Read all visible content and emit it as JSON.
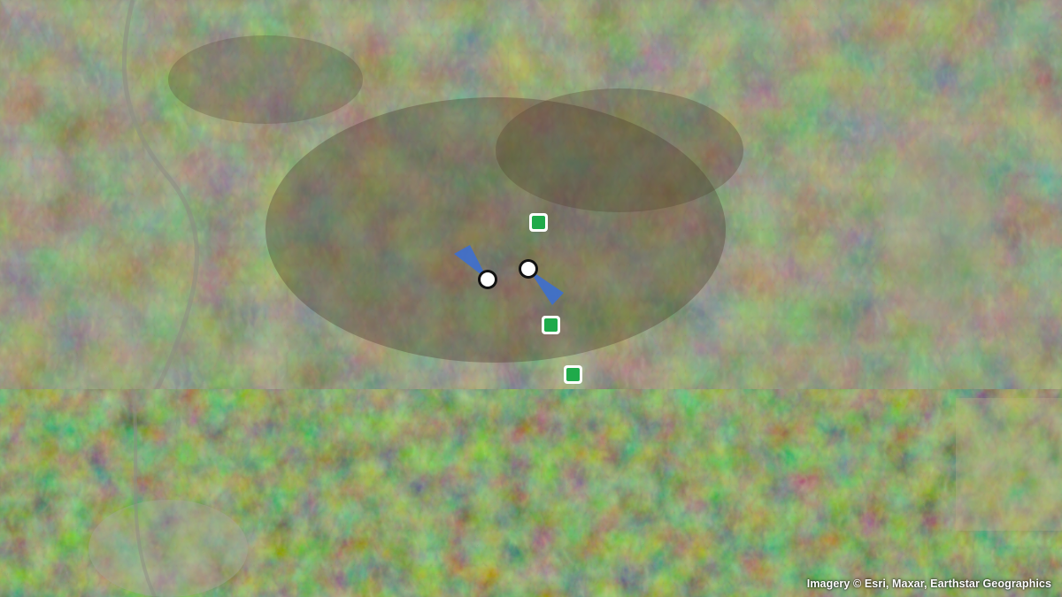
{
  "attribution": "Imagery © Esri, Maxar, Earthstar Geographics",
  "markers": {
    "camera_icon": "white-circle-marker",
    "camera_color": "#ffffff",
    "camera_outline": "#111111",
    "view_cone_color": "#3a6fd6",
    "station_icon": "green-square-marker",
    "station_color": "#1faa4a",
    "station_outline": "#ffffff"
  },
  "colors": {
    "upper_tile_tint": "#404636",
    "lower_tile_tint": "#3f5a2a"
  }
}
